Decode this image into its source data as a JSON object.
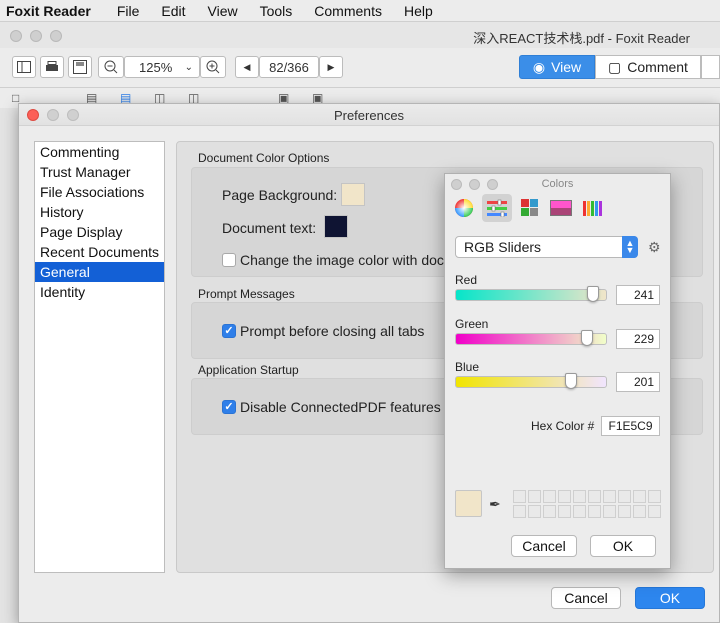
{
  "menubar": {
    "app": "Foxit Reader",
    "items": [
      "File",
      "Edit",
      "View",
      "Tools",
      "Comments",
      "Help"
    ]
  },
  "window": {
    "title": "深入REACT技术栈.pdf - Foxit Reader"
  },
  "toolbar": {
    "zoom": "125%",
    "page": "82/366",
    "view_label": "View",
    "comment_label": "Comment"
  },
  "prefs": {
    "title": "Preferences",
    "sidebar": [
      {
        "label": "Commenting"
      },
      {
        "label": "Trust Manager"
      },
      {
        "label": "File Associations"
      },
      {
        "label": "History"
      },
      {
        "label": "Page Display"
      },
      {
        "label": "Recent Documents"
      },
      {
        "label": "General"
      },
      {
        "label": "Identity"
      }
    ],
    "selected": "General",
    "doc_color": {
      "section": "Document Color Options",
      "page_background": "Page Background:",
      "document_text": "Document text:",
      "change_image": "Change the image color with docu",
      "page_bg_color": "#F1E5C9",
      "text_color": "#0F1433"
    },
    "prompt": {
      "section": "Prompt Messages",
      "before_closing": "Prompt before closing all tabs"
    },
    "startup": {
      "section": "Application Startup",
      "disable_cpdf": "Disable ConnectedPDF features"
    },
    "cancel": "Cancel",
    "ok": "OK"
  },
  "colors": {
    "title": "Colors",
    "mode": "RGB Sliders",
    "red_label": "Red",
    "green_label": "Green",
    "blue_label": "Blue",
    "red": "241",
    "green": "229",
    "blue": "201",
    "hex_label": "Hex Color #",
    "hex": "F1E5C9",
    "cancel": "Cancel",
    "ok": "OK",
    "accent": "#3B8EE8"
  }
}
